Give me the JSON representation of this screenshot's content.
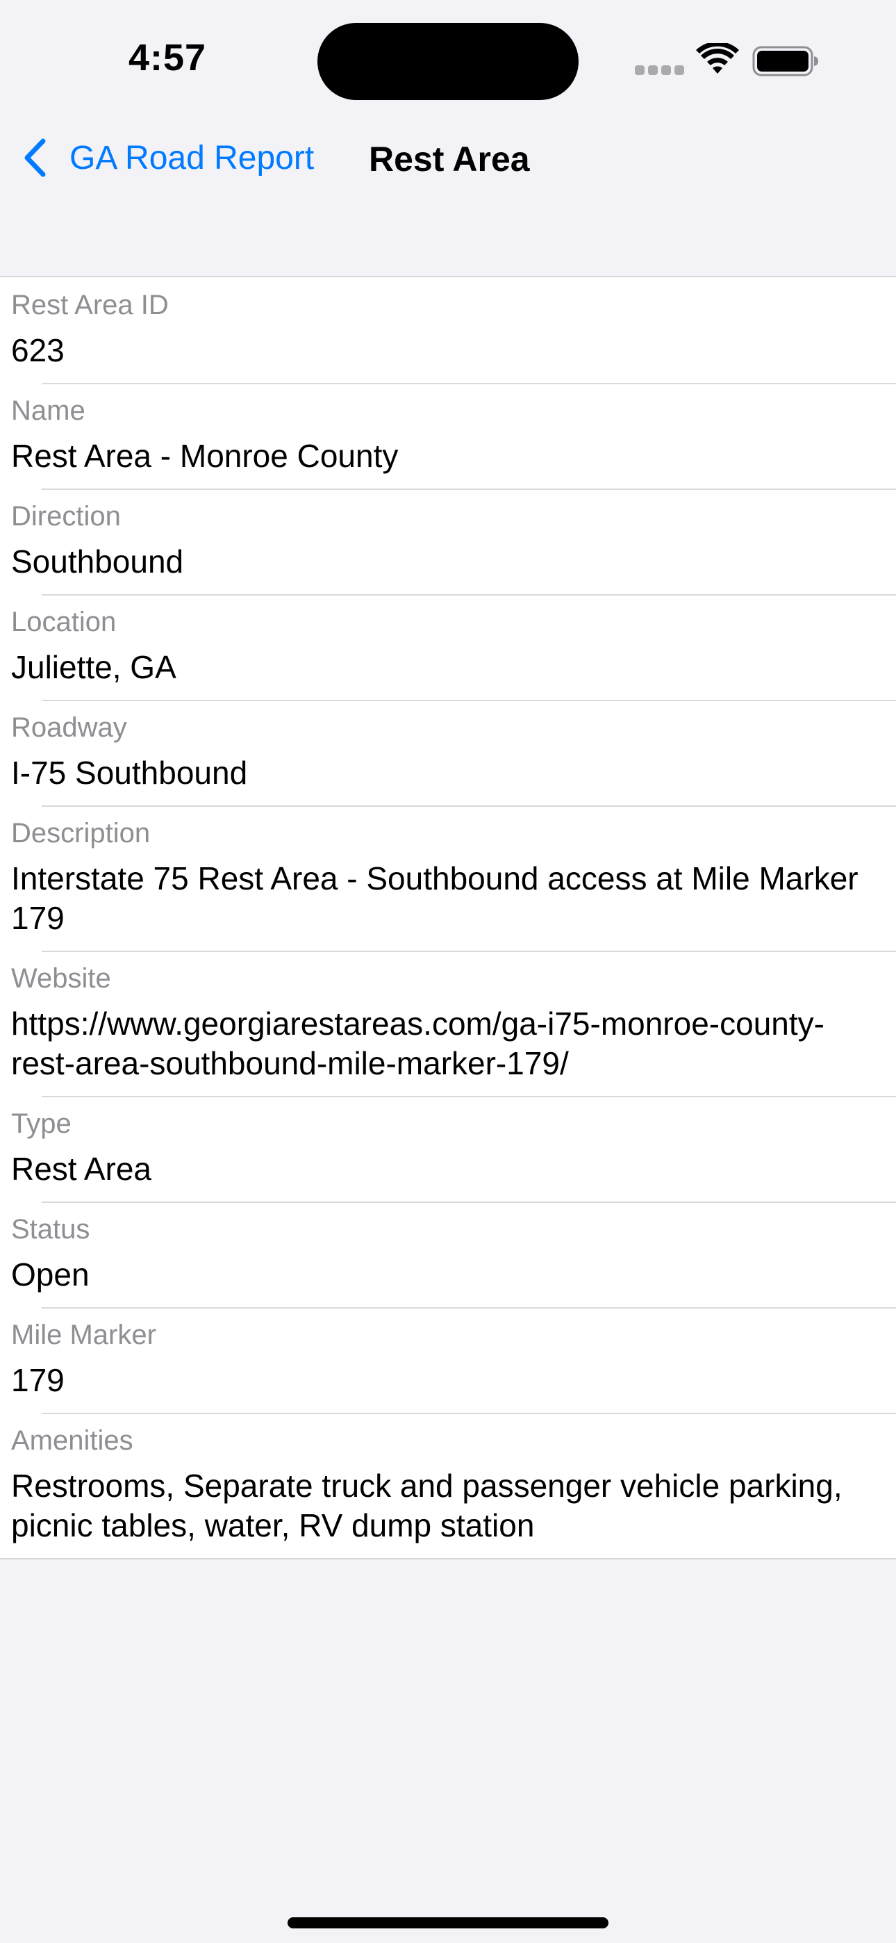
{
  "status_bar": {
    "time": "4:57",
    "icons": [
      "cellular-signal-icon",
      "wifi-icon",
      "battery-icon"
    ]
  },
  "nav": {
    "back_label": "GA Road Report",
    "title": "Rest Area",
    "accent_color": "#007aff"
  },
  "rows": [
    {
      "label": "Rest Area ID",
      "value": "623"
    },
    {
      "label": "Name",
      "value": "Rest Area - Monroe County"
    },
    {
      "label": "Direction",
      "value": "Southbound"
    },
    {
      "label": "Location",
      "value": "Juliette, GA"
    },
    {
      "label": "Roadway",
      "value": "I-75 Southbound"
    },
    {
      "label": "Description",
      "value": "Interstate 75 Rest Area - Southbound access at Mile Marker 179"
    },
    {
      "label": "Website",
      "value": "https://www.georgiarestareas.com/ga-i75-monroe-county-rest-area-southbound-mile-marker-179/"
    },
    {
      "label": "Type",
      "value": "Rest Area"
    },
    {
      "label": "Status",
      "value": "Open"
    },
    {
      "label": "Mile Marker",
      "value": "179"
    },
    {
      "label": "Amenities",
      "value": "Restrooms, Separate truck and passenger vehicle parking, picnic tables, water, RV dump station"
    }
  ]
}
